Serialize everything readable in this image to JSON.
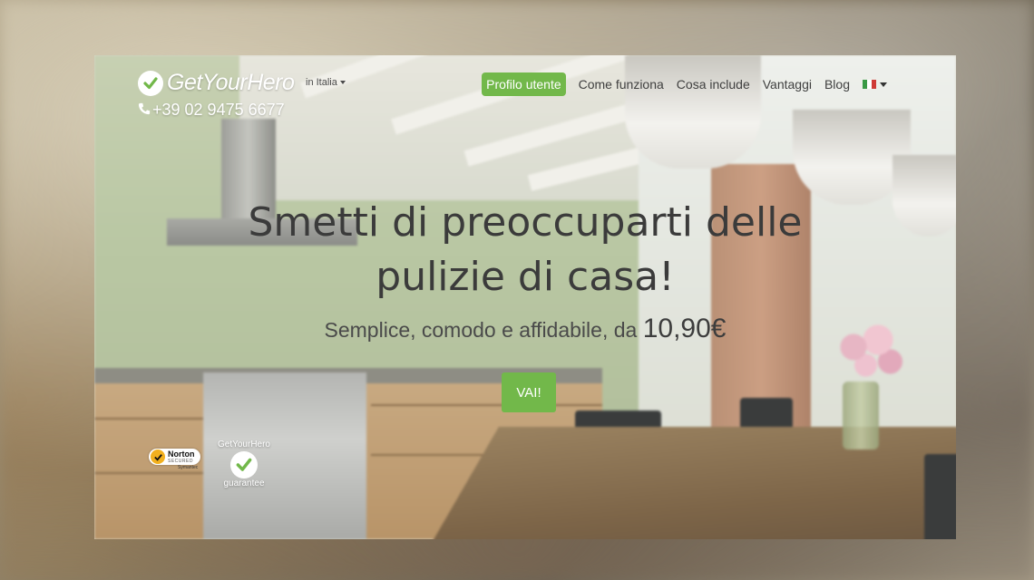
{
  "brand": {
    "name": "GetYourHero",
    "phone": "+39 02 9475 6677",
    "accent": "#72b84a"
  },
  "region": {
    "label": "in Italia"
  },
  "nav": {
    "items": [
      "Profilo utente",
      "Come funziona",
      "Cosa include",
      "Vantaggi",
      "Blog"
    ],
    "language": "IT"
  },
  "hero": {
    "title_line1": "Smetti di preoccuparti delle",
    "title_line2": "pulizie di casa!",
    "subtitle": "Semplice, comodo e affidabile, da ",
    "price": "10,90€",
    "cta": "VAI!"
  },
  "badges": {
    "norton": {
      "name": "Norton",
      "secured": "SECURED",
      "by": "Symantec"
    },
    "guarantee": {
      "top": "GetYourHero",
      "bottom": "guarantee"
    }
  }
}
